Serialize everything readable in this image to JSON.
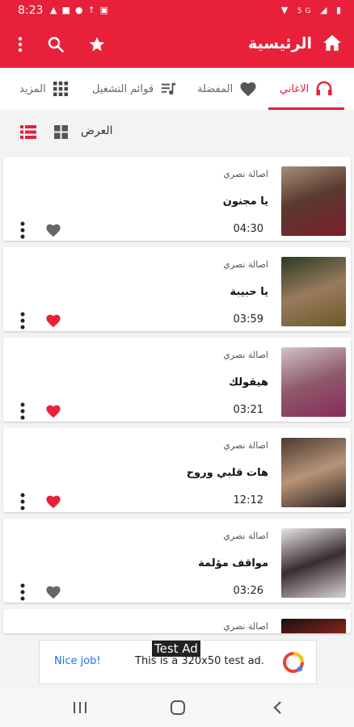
{
  "status_bar": {
    "time": "8:23",
    "network": "5G"
  },
  "app_bar": {
    "title": "الرئيسية"
  },
  "tabs": [
    {
      "label": "الاغاني",
      "icon": "headphones-icon",
      "active": true
    },
    {
      "label": "المفضلة",
      "icon": "heart-icon",
      "active": false
    },
    {
      "label": "قوائم التشغيل",
      "icon": "playlist-icon",
      "active": false
    },
    {
      "label": "المزيد",
      "icon": "grid-icon",
      "active": false
    }
  ],
  "view_bar": {
    "label": "العرض"
  },
  "songs": [
    {
      "artist": "اصالة نصري",
      "title": "يا مجنون",
      "duration": "04:30",
      "favorite": false
    },
    {
      "artist": "اصالة نصري",
      "title": "يا حبيبة",
      "duration": "03:59",
      "favorite": true
    },
    {
      "artist": "اصالة نصري",
      "title": "هيقولك",
      "duration": "03:21",
      "favorite": true
    },
    {
      "artist": "اصالة نصري",
      "title": "هات قلبي وروح",
      "duration": "12:12",
      "favorite": true
    },
    {
      "artist": "اصالة نصري",
      "title": "مواقف مؤلمة",
      "duration": "03:26",
      "favorite": false
    },
    {
      "artist": "اصالة نصري"
    }
  ],
  "ad": {
    "tag": "Test Ad",
    "cta": "Nice job!",
    "text": "This is a 320x50 test ad."
  },
  "colors": {
    "accent": "#e8203a",
    "heart_favorite": "#e8203a",
    "heart_default": "#666666"
  }
}
